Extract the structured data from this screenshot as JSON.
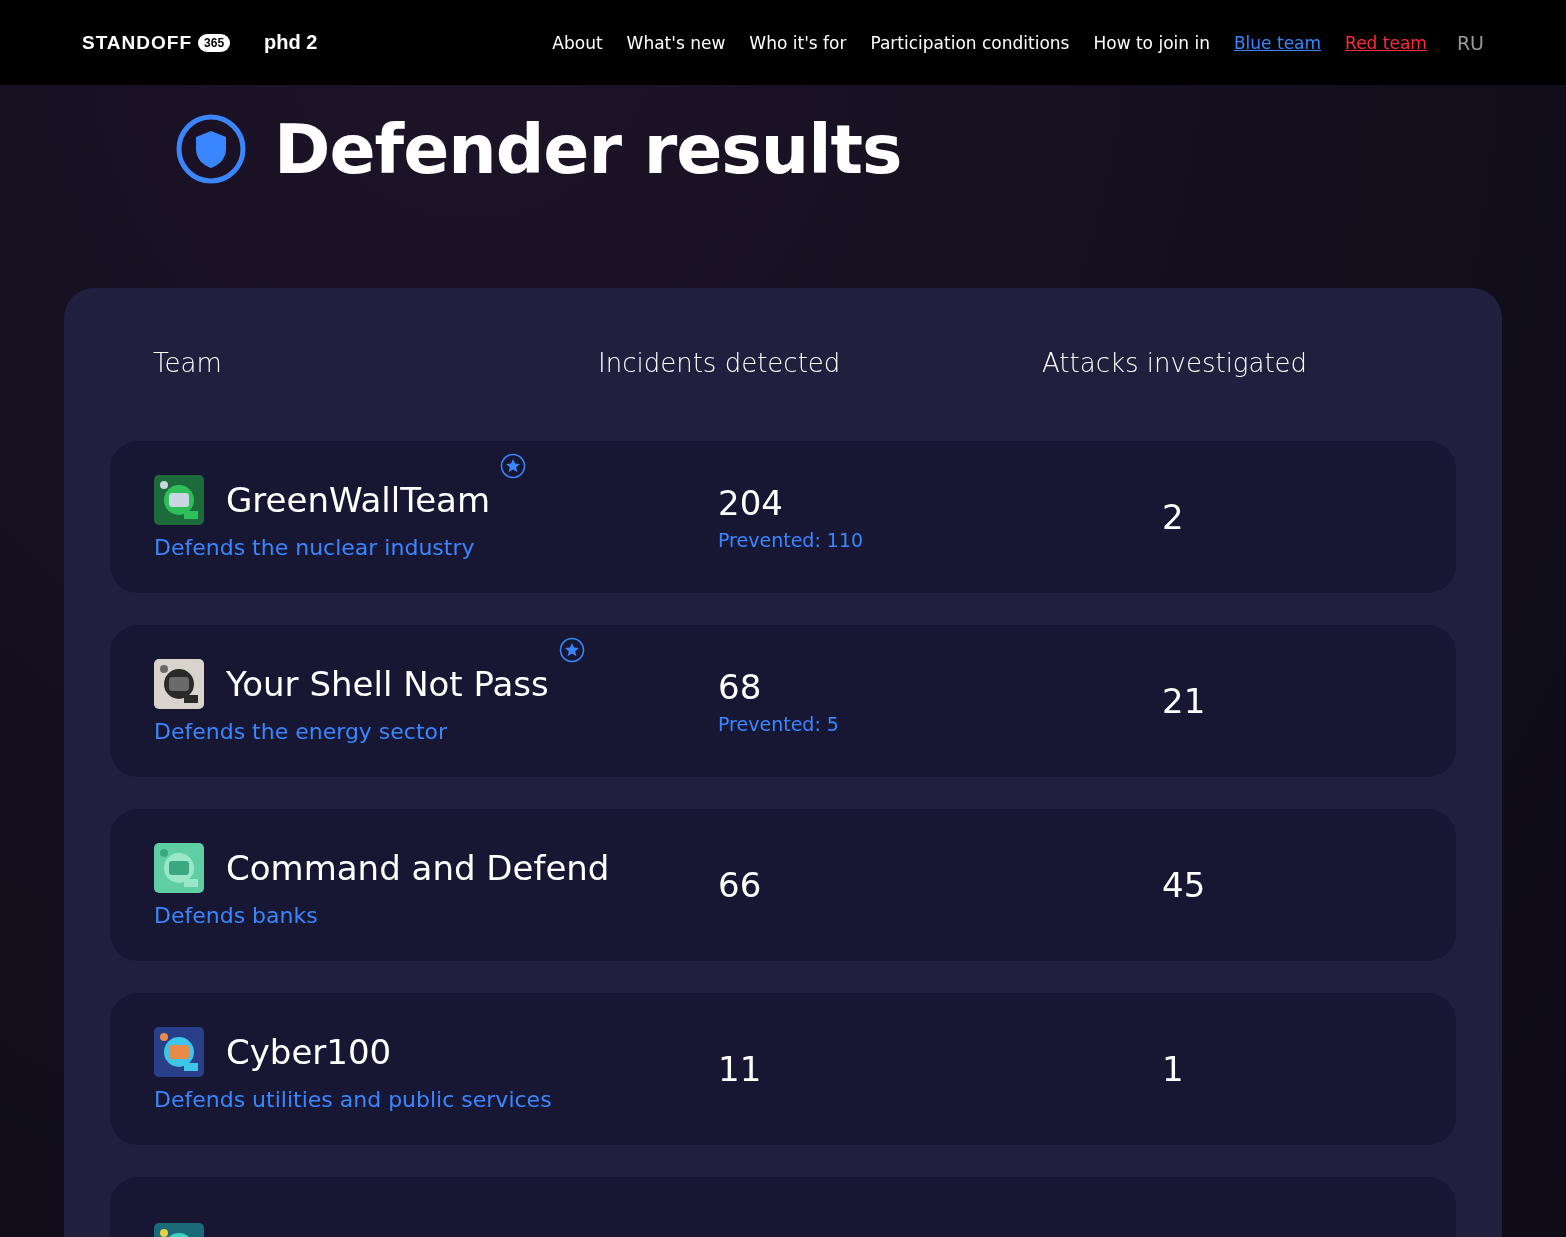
{
  "nav": {
    "logo": "STANDOFF",
    "logo_badge": "365",
    "logo_2": "phd 2",
    "links": [
      {
        "label": "About",
        "kind": "plain"
      },
      {
        "label": "What's new",
        "kind": "plain"
      },
      {
        "label": "Who it's for",
        "kind": "plain"
      },
      {
        "label": "Participation conditions",
        "kind": "plain"
      },
      {
        "label": "How to join in",
        "kind": "plain"
      },
      {
        "label": "Blue team",
        "kind": "blue"
      },
      {
        "label": "Red team",
        "kind": "red"
      }
    ],
    "language": {
      "label": "RU",
      "selected": false
    }
  },
  "title": "Defender results",
  "table": {
    "columns": [
      "Team",
      "Incidents detected",
      "Attacks investigated"
    ],
    "rows": [
      {
        "kind": "team",
        "name": "GreenWallTeam",
        "starred": true,
        "sector": "Defends the nuclear industry",
        "incidents": "204",
        "prevented": "Prevented: 110",
        "attacks": "2"
      },
      {
        "kind": "team",
        "name": "Your Shell Not Pass",
        "starred": true,
        "sector": "Defends the energy sector",
        "incidents": "68",
        "prevented": "Prevented: 5",
        "attacks": "21"
      },
      {
        "kind": "team",
        "name": "Command and Defend",
        "starred": false,
        "sector": "Defends banks",
        "incidents": "66",
        "attacks": "45"
      },
      {
        "kind": "team",
        "name": "Cyber100",
        "starred": false,
        "sector": "Defends utilities and public services",
        "incidents": "11",
        "attacks": "1"
      },
      {
        "kind": "picture"
      }
    ]
  }
}
